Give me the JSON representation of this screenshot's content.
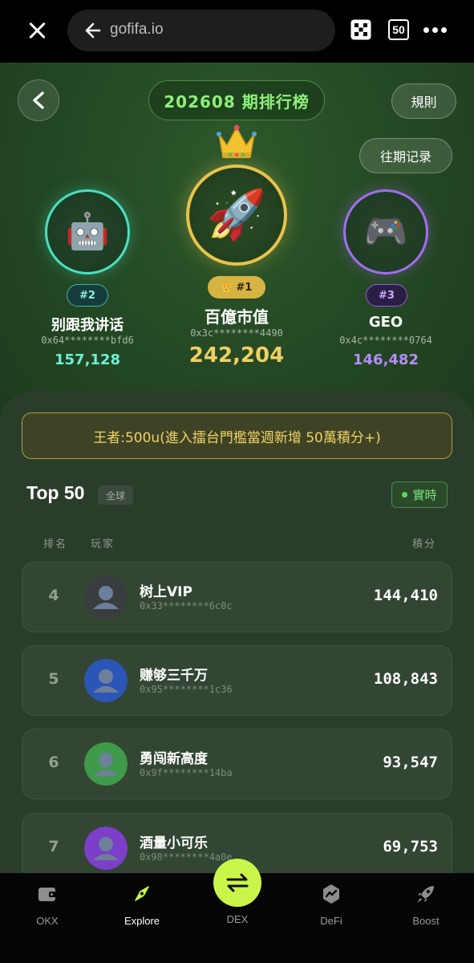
{
  "browser": {
    "url": "gofifa.io",
    "tab_count": "50"
  },
  "hero": {
    "period_title": "202608 期排行榜",
    "rules_label": "規則",
    "history_label": "往期记录",
    "podium": [
      {
        "rank_label": "#2",
        "name": "别跟我讲话",
        "address": "0x64********bfd6",
        "score": "157,128",
        "avatar": "🤖",
        "color": "#4be0c3"
      },
      {
        "rank_label": "#1",
        "name": "百億市值",
        "address": "0x3c********4490",
        "score": "242,204",
        "avatar": "🚀",
        "color": "#e8c34a",
        "badge_emoji": "👑"
      },
      {
        "rank_label": "#3",
        "name": "GEO",
        "address": "0x4c********0764",
        "score": "146,482",
        "avatar": "🎮",
        "color": "#a36df2"
      }
    ],
    "crown_icon": "👑"
  },
  "board": {
    "banner": "王者:500u(進入擂台門檻當週新增 50萬積分+)",
    "title": "Top 50",
    "scope_tag": "全球",
    "live_label": "實時",
    "columns": {
      "rank": "排名",
      "player": "玩家",
      "score": "積分"
    },
    "rows": [
      {
        "rank": "4",
        "name": "树上VIP",
        "address": "0x33********6c0c",
        "score": "144,410",
        "avatar_color": "#3a3d40"
      },
      {
        "rank": "5",
        "name": "赚够三千万",
        "address": "0x95********1c36",
        "score": "108,843",
        "avatar_color": "#2c55b8"
      },
      {
        "rank": "6",
        "name": "勇闯新高度",
        "address": "0x9f********14ba",
        "score": "93,547",
        "avatar_color": "#3f9a4a"
      },
      {
        "rank": "7",
        "name": "酒量小可乐",
        "address": "0x98********4a0e",
        "score": "69,753",
        "avatar_color": "#7b3fc9"
      }
    ]
  },
  "nav": {
    "items": [
      {
        "label": "OKX",
        "icon": "wallet-icon"
      },
      {
        "label": "Explore",
        "icon": "compass-icon"
      },
      {
        "label": "DEX",
        "icon": "swap-icon"
      },
      {
        "label": "DeFi",
        "icon": "defi-icon"
      },
      {
        "label": "Boost",
        "icon": "rocket-icon"
      }
    ],
    "active": "Explore",
    "accent": "#c9f54a"
  }
}
